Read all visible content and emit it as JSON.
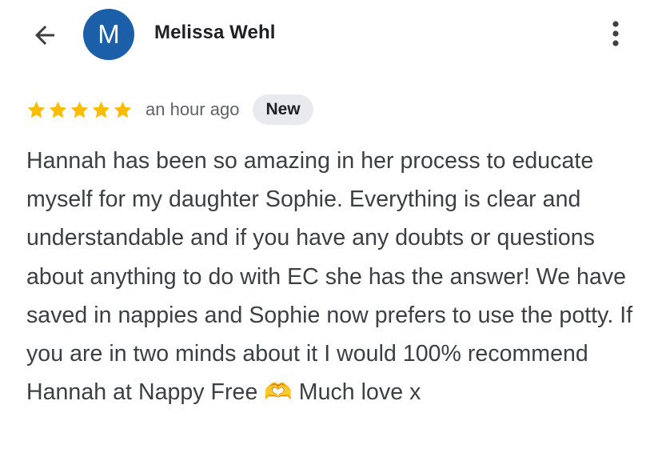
{
  "header": {
    "back_icon": "arrow-left-icon",
    "avatar_initial": "M",
    "avatar_color": "#1a5fa8",
    "author_name": "Melissa Wehl",
    "more_icon": "more-vert-icon"
  },
  "review": {
    "rating": 5,
    "rating_max": 5,
    "star_color": "#fbbc04",
    "time": "an hour ago",
    "badge": "New",
    "text": "Hannah has been so amazing in her process to educate myself for my daughter Sophie. Everything is clear and understandable and if you have any doubts or questions about anything to do with EC she has the answer! We have saved in nappies and Sophie now prefers to use the potty. If you are in two minds about it I would 100% recommend Hannah at Nappy Free 🫶 Much love x"
  }
}
